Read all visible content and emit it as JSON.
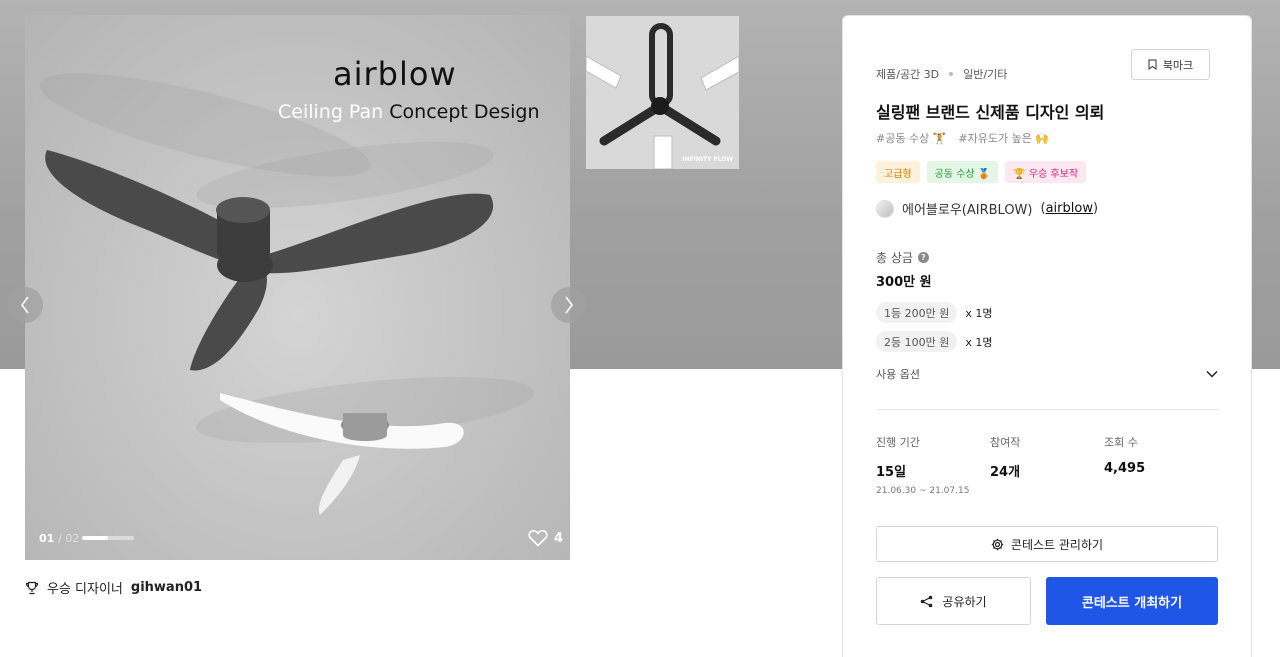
{
  "gallery": {
    "brand_logo_text": "airblow",
    "brand_sub_light": "Ceiling Pan",
    "brand_sub_dark": "Concept Design",
    "pager_current": "01",
    "pager_total": "02",
    "pager_progress": 0.5,
    "like_count": "4",
    "thumbnail_caption": "INFINITY FLOW"
  },
  "designer": {
    "label": "우승 디자이너",
    "name": "gihwan01"
  },
  "panel": {
    "category": "제품/공간 3D",
    "subcategory": "일반/기타",
    "bookmark_label": "북마크",
    "title": "실링팬 브랜드 신제품 디자인 의뢰",
    "tags": [
      "#공동 수상 🏋",
      "#자유도가 높은 🙌"
    ],
    "badges": {
      "level": "고급형",
      "joint": "공동 수상 🥉",
      "candidate": "🏆 우승 후보작"
    },
    "host_name": "에어블로우(AIRBLOW)",
    "host_handle": "airblow",
    "prize_label": "총 상금",
    "prize_total": "300만 원",
    "prizes": [
      {
        "rank": "1등 200만 원",
        "count": "x 1명"
      },
      {
        "rank": "2등 100만 원",
        "count": "x 1명"
      }
    ],
    "usage_label": "사용 옵션",
    "stats": {
      "period_label": "진행 기간",
      "period_value": "15일",
      "period_range": "21.06.30 ~ 21.07.15",
      "entries_label": "참여작",
      "entries_value": "24개",
      "views_label": "조회 수",
      "views_value": "4,495"
    },
    "manage_label": "콘테스트 관리하기",
    "share_label": "공유하기",
    "host_contest_label": "콘테스트 개최하기"
  },
  "colors": {
    "primary": "#1f56e8",
    "badge_level": "#e07a00",
    "badge_joint": "#2b9a3e",
    "badge_candidate": "#d0267a"
  }
}
